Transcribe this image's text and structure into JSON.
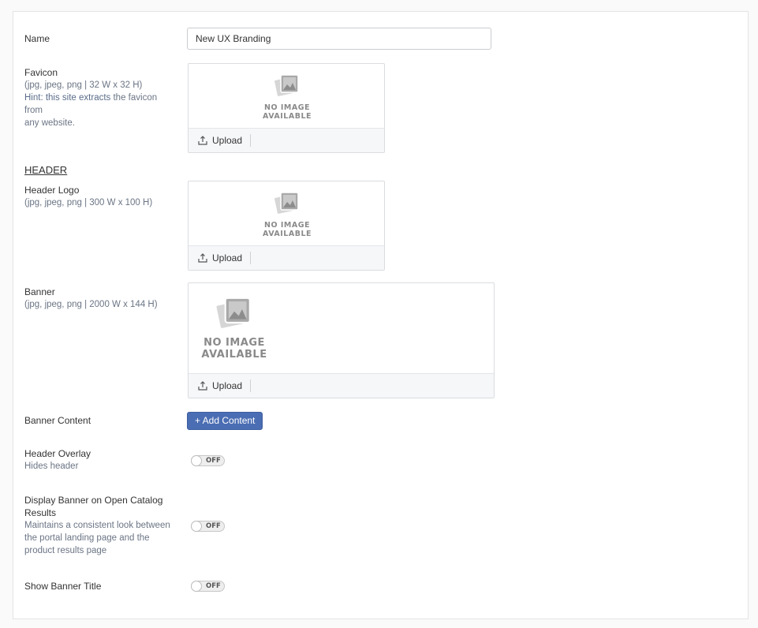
{
  "name_field": {
    "label": "Name",
    "value": "New UX Branding"
  },
  "favicon": {
    "label": "Favicon",
    "spec": "(jpg, jpeg, png | 32 W x 32 H)",
    "hint_prefix": "Hint: this site extracts",
    "hint_rest": " the favicon from",
    "hint_line2": "any website.",
    "no_image_line1": "NO IMAGE",
    "no_image_line2": "AVAILABLE",
    "upload_label": "Upload"
  },
  "header_section": {
    "title": "HEADER"
  },
  "header_logo": {
    "label": "Header Logo",
    "spec": "(jpg, jpeg, png | 300 W x 100 H)",
    "no_image_line1": "NO IMAGE",
    "no_image_line2": "AVAILABLE",
    "upload_label": "Upload"
  },
  "banner": {
    "label": "Banner",
    "spec": "(jpg, jpeg, png | 2000 W x 144 H)",
    "no_image_line1": "NO IMAGE",
    "no_image_line2": "AVAILABLE",
    "upload_label": "Upload"
  },
  "banner_content": {
    "label": "Banner Content",
    "button_label": "+ Add Content"
  },
  "header_overlay": {
    "label": "Header Overlay",
    "description": "Hides header",
    "toggle_text": "OFF"
  },
  "display_banner": {
    "label_line1": "Display Banner on Open Catalog",
    "label_line2": "Results",
    "desc_line1": "Maintains a consistent look between",
    "desc_line2": "the portal landing page and the",
    "desc_line3": "product results page",
    "toggle_text": "OFF"
  },
  "show_banner_title": {
    "label": "Show Banner Title",
    "toggle_text": "OFF"
  },
  "colors": {
    "primary": "#4a6db3",
    "hint": "#5a6c8a"
  },
  "icons": {
    "placeholder": "image-placeholder-icon",
    "upload": "upload-icon"
  }
}
